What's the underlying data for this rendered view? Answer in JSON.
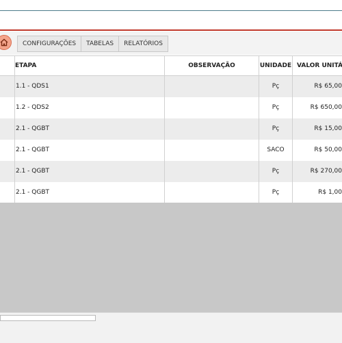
{
  "toolbar": {
    "home_icon": "home-icon",
    "tabs": [
      "CONFIGURAÇÕES",
      "TABELAS",
      "RELATÓRIOS"
    ]
  },
  "table": {
    "columns": [
      "ETAPA",
      "OBSERVAÇÃO",
      "UNIDADE",
      "VALOR UNITÁ"
    ],
    "rows": [
      {
        "etapa": "1.1 - QDS1",
        "observacao": "",
        "unidade": "Pç",
        "valor": "R$ 65,00"
      },
      {
        "etapa": "1.2 - QDS2",
        "observacao": "",
        "unidade": "Pç",
        "valor": "R$ 650,00"
      },
      {
        "etapa": "2.1 - QGBT",
        "observacao": "",
        "unidade": "Pç",
        "valor": "R$ 15,00"
      },
      {
        "etapa": "2.1 - QGBT",
        "observacao": "",
        "unidade": "SACO",
        "valor": "R$ 50,00"
      },
      {
        "etapa": "2.1 - QGBT",
        "observacao": "",
        "unidade": "Pç",
        "valor": "R$ 270,00"
      },
      {
        "etapa": "2.1 - QGBT",
        "observacao": "",
        "unidade": "Pç",
        "valor": "R$ 1,00"
      }
    ]
  },
  "colors": {
    "accent_line": "#c0392b",
    "header_line": "#4d7c8a",
    "home_button": "#f4a48b",
    "empty_area": "#c8c8c8"
  }
}
